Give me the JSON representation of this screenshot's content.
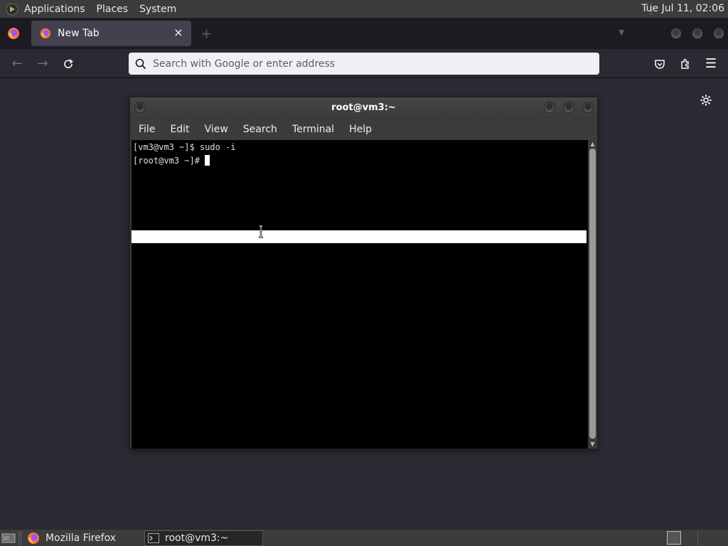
{
  "topbar": {
    "menus": [
      "Applications",
      "Places",
      "System"
    ],
    "clock": "Tue Jul 11, 02:06"
  },
  "browser": {
    "tab_title": "New Tab",
    "tab_close": "×",
    "new_tab": "+",
    "url_placeholder": "Search with Google or enter address"
  },
  "terminal": {
    "title": "root@vm3:~",
    "menus": [
      "File",
      "Edit",
      "View",
      "Search",
      "Terminal",
      "Help"
    ],
    "lines": [
      "[vm3@vm3 ~]$ sudo -i",
      "[root@vm3 ~]# "
    ]
  },
  "taskbar": {
    "items": [
      "Mozilla Firefox",
      "root@vm3:~"
    ]
  },
  "colors": {
    "panel": "#3c3c3c",
    "browser_bg": "#2b2a33",
    "tabstrip": "#1c1b22",
    "terminal_bg": "#000000"
  }
}
